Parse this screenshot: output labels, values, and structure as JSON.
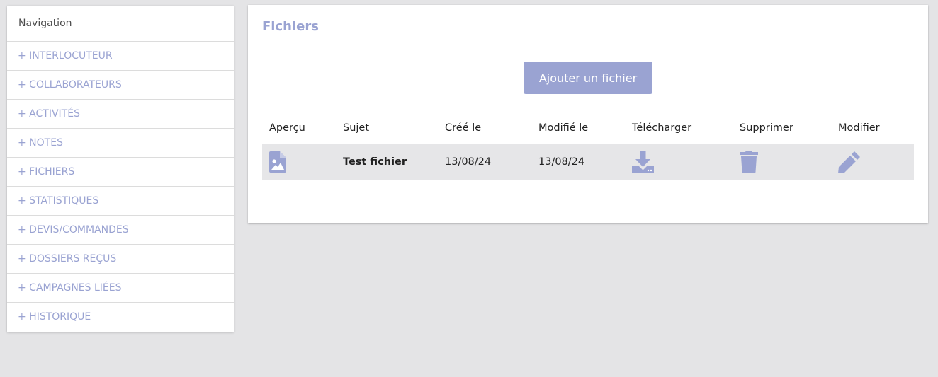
{
  "sidebar": {
    "title": "Navigation",
    "items": [
      {
        "label": "+ INTERLOCUTEUR"
      },
      {
        "label": "+ COLLABORATEURS"
      },
      {
        "label": "+ ACTIVITÉS"
      },
      {
        "label": "+ NOTES"
      },
      {
        "label": "+ FICHIERS"
      },
      {
        "label": "+ STATISTIQUES"
      },
      {
        "label": "+ DEVIS/COMMANDES"
      },
      {
        "label": "+ DOSSIERS REÇUS"
      },
      {
        "label": "+ CAMPAGNES LIÉES"
      },
      {
        "label": "+ HISTORIQUE"
      }
    ]
  },
  "files": {
    "title": "Fichiers",
    "add_button_label": "Ajouter un fichier",
    "columns": [
      "Aperçu",
      "Sujet",
      "Créé le",
      "Modifié le",
      "Télécharger",
      "Supprimer",
      "Modifier"
    ],
    "rows": [
      {
        "preview_icon": "image-file-icon",
        "subject": "Test fichier",
        "created": "13/08/24",
        "modified": "13/08/24",
        "download_icon": "download-icon",
        "delete_icon": "trash-icon",
        "edit_icon": "pencil-icon"
      }
    ]
  },
  "colors": {
    "accent": "#9aa3d2",
    "background": "#e4e4e6",
    "row_background": "#e6e6e8"
  }
}
